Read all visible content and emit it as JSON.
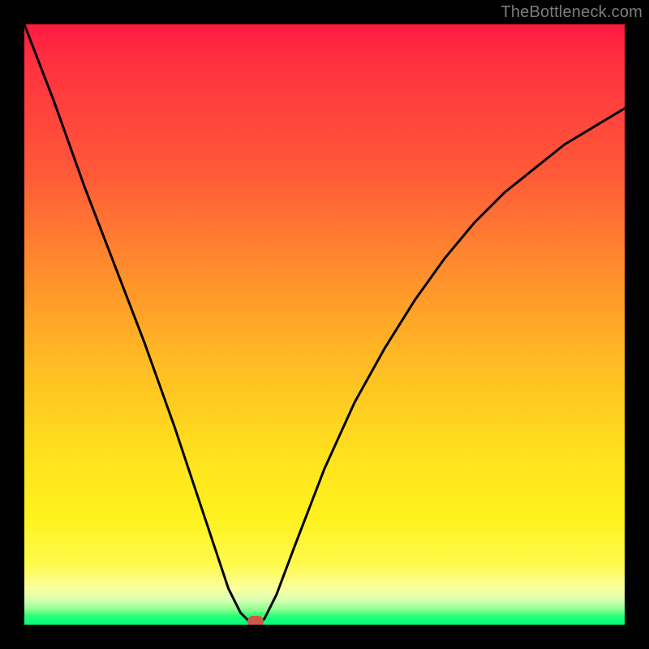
{
  "watermark": "TheBottleneck.com",
  "chart_data": {
    "type": "line",
    "title": "",
    "xlabel": "",
    "ylabel": "",
    "x": [
      0.0,
      0.05,
      0.1,
      0.15,
      0.2,
      0.25,
      0.28,
      0.3,
      0.32,
      0.34,
      0.36,
      0.38,
      0.39,
      0.4,
      0.42,
      0.45,
      0.5,
      0.55,
      0.6,
      0.65,
      0.7,
      0.75,
      0.8,
      0.85,
      0.9,
      0.95,
      1.0
    ],
    "y": [
      1.0,
      0.87,
      0.73,
      0.6,
      0.47,
      0.33,
      0.24,
      0.18,
      0.12,
      0.06,
      0.02,
      0.0,
      0.0,
      0.01,
      0.05,
      0.13,
      0.26,
      0.37,
      0.46,
      0.54,
      0.61,
      0.67,
      0.72,
      0.76,
      0.8,
      0.83,
      0.86
    ],
    "ylim": [
      0,
      1
    ],
    "xlim": [
      0,
      1
    ],
    "grid": false,
    "legend": false,
    "marker": {
      "x": 0.385,
      "y": 0.0
    },
    "background_gradient": {
      "top": "#ff1a42",
      "mid1": "#ff8a2e",
      "mid2": "#ffe21e",
      "bottom": "#00ff7a"
    }
  }
}
